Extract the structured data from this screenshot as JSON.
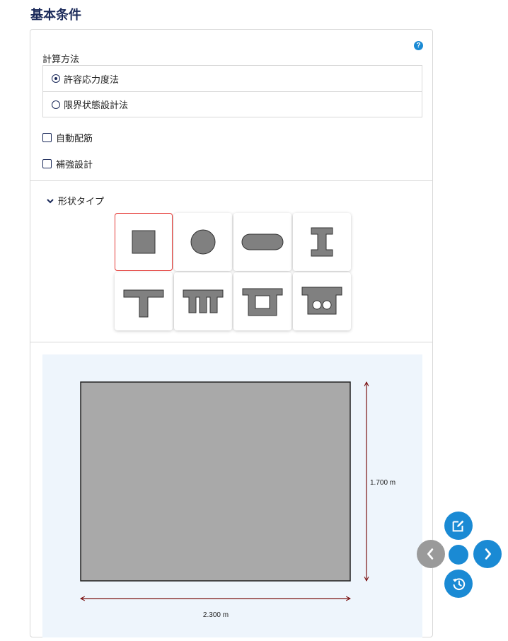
{
  "page": {
    "title": "基本条件"
  },
  "calc_method": {
    "label": "計算方法",
    "options": [
      {
        "label": "許容応力度法",
        "selected": true
      },
      {
        "label": "限界状態設計法",
        "selected": false
      }
    ]
  },
  "checkboxes": [
    {
      "label": "自動配筋",
      "checked": false
    },
    {
      "label": "補強設計",
      "checked": false
    }
  ],
  "shape_type": {
    "label": "形状タイプ",
    "shapes": [
      {
        "icon": "rectangle-shape-icon",
        "selected": true
      },
      {
        "icon": "circle-shape-icon",
        "selected": false
      },
      {
        "icon": "oval-shape-icon",
        "selected": false
      },
      {
        "icon": "i-beam-shape-icon",
        "selected": false
      },
      {
        "icon": "t-beam-shape-icon",
        "selected": false
      },
      {
        "icon": "double-t-shape-icon",
        "selected": false
      },
      {
        "icon": "hollow-box-shape-icon",
        "selected": false
      },
      {
        "icon": "box-two-holes-shape-icon",
        "selected": false
      }
    ]
  },
  "preview": {
    "width_label": "2.300 m",
    "height_label": "1.700 m"
  },
  "colors": {
    "accent": "#1a8ad4",
    "title": "#1b2a5a",
    "dimension": "#7a1010",
    "shape_fill": "#a9a9a9",
    "preview_bg": "#eef5fc",
    "selected_border": "#e53935"
  }
}
